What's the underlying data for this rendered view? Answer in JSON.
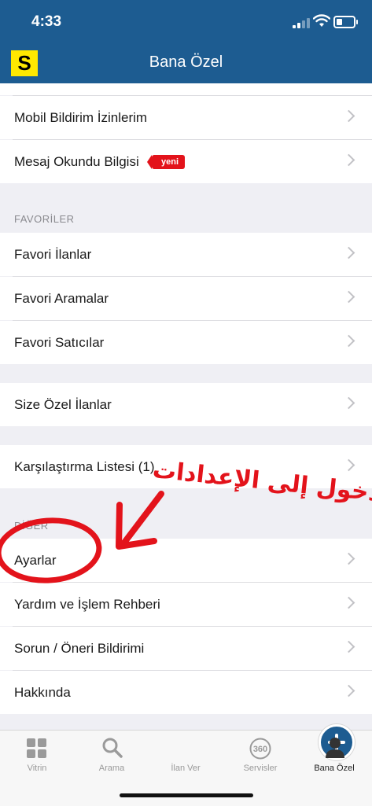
{
  "status": {
    "time": "4:33"
  },
  "nav": {
    "logo": "S",
    "title": "Bana Özel"
  },
  "rows": {
    "mobil_bildirim": "Mobil Bildirim İzinlerim",
    "mesaj_okundu": "Mesaj Okundu Bilgisi",
    "mesaj_badge": "yeni",
    "favoriler_header": "FAVORİLER",
    "favori_ilanlar": "Favori İlanlar",
    "favori_aramalar": "Favori Aramalar",
    "favori_saticilar": "Favori Satıcılar",
    "size_ozel": "Size Özel İlanlar",
    "karsilastirma": "Karşılaştırma Listesi (1)",
    "diger_header": "DİĞER",
    "ayarlar": "Ayarlar",
    "yardim": "Yardım ve İşlem Rehberi",
    "sorun": "Sorun / Öneri Bildirimi",
    "hakkinda": "Hakkında"
  },
  "annotation": {
    "text": "الدخول إلى الإعدادات",
    "color": "#e3131b"
  },
  "tabs": [
    {
      "label": "Vitrin",
      "icon": "grid-icon"
    },
    {
      "label": "Arama",
      "icon": "search-icon"
    },
    {
      "label": "İlan Ver",
      "icon": "plus-icon"
    },
    {
      "label": "Servisler",
      "icon": "360-icon"
    },
    {
      "label": "Bana Özel",
      "icon": "person-icon"
    }
  ],
  "colors": {
    "brand": "#1d5c91",
    "logo": "#ffe800",
    "badge": "#e3131b"
  }
}
